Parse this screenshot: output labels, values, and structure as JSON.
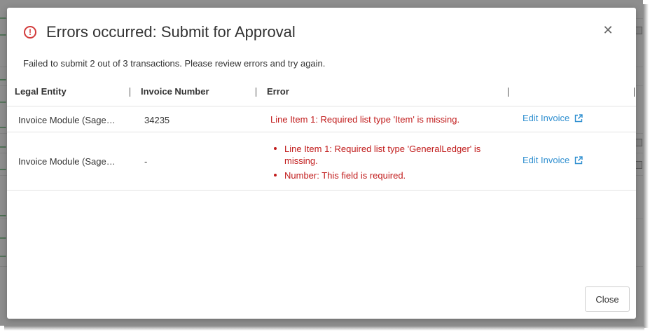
{
  "modal": {
    "icon": "error-circle-icon",
    "title": "Errors occurred: Submit for Approval",
    "close_icon": "close-icon",
    "summary": "Failed to submit 2 out of 3 transactions. Please review errors and try again.",
    "close_button": "Close",
    "accent_error_color": "#c11b1b",
    "link_color": "#2f8fd0"
  },
  "table": {
    "columns": [
      "Legal Entity",
      "Invoice Number",
      "Error",
      ""
    ],
    "rows": [
      {
        "legal_entity": "Invoice Module (Sage…",
        "invoice_number": "34235",
        "error": "Line Item 1: Required list type 'Item' is missing.",
        "action": "Edit Invoice",
        "action_icon": "external-link-icon"
      },
      {
        "legal_entity": "Invoice Module (Sage…",
        "invoice_number": "-",
        "errors": [
          "Line Item 1: Required list type 'GeneralLedger' is missing.",
          "Number: This field is required."
        ],
        "action": "Edit Invoice",
        "action_icon": "external-link-icon"
      }
    ]
  }
}
